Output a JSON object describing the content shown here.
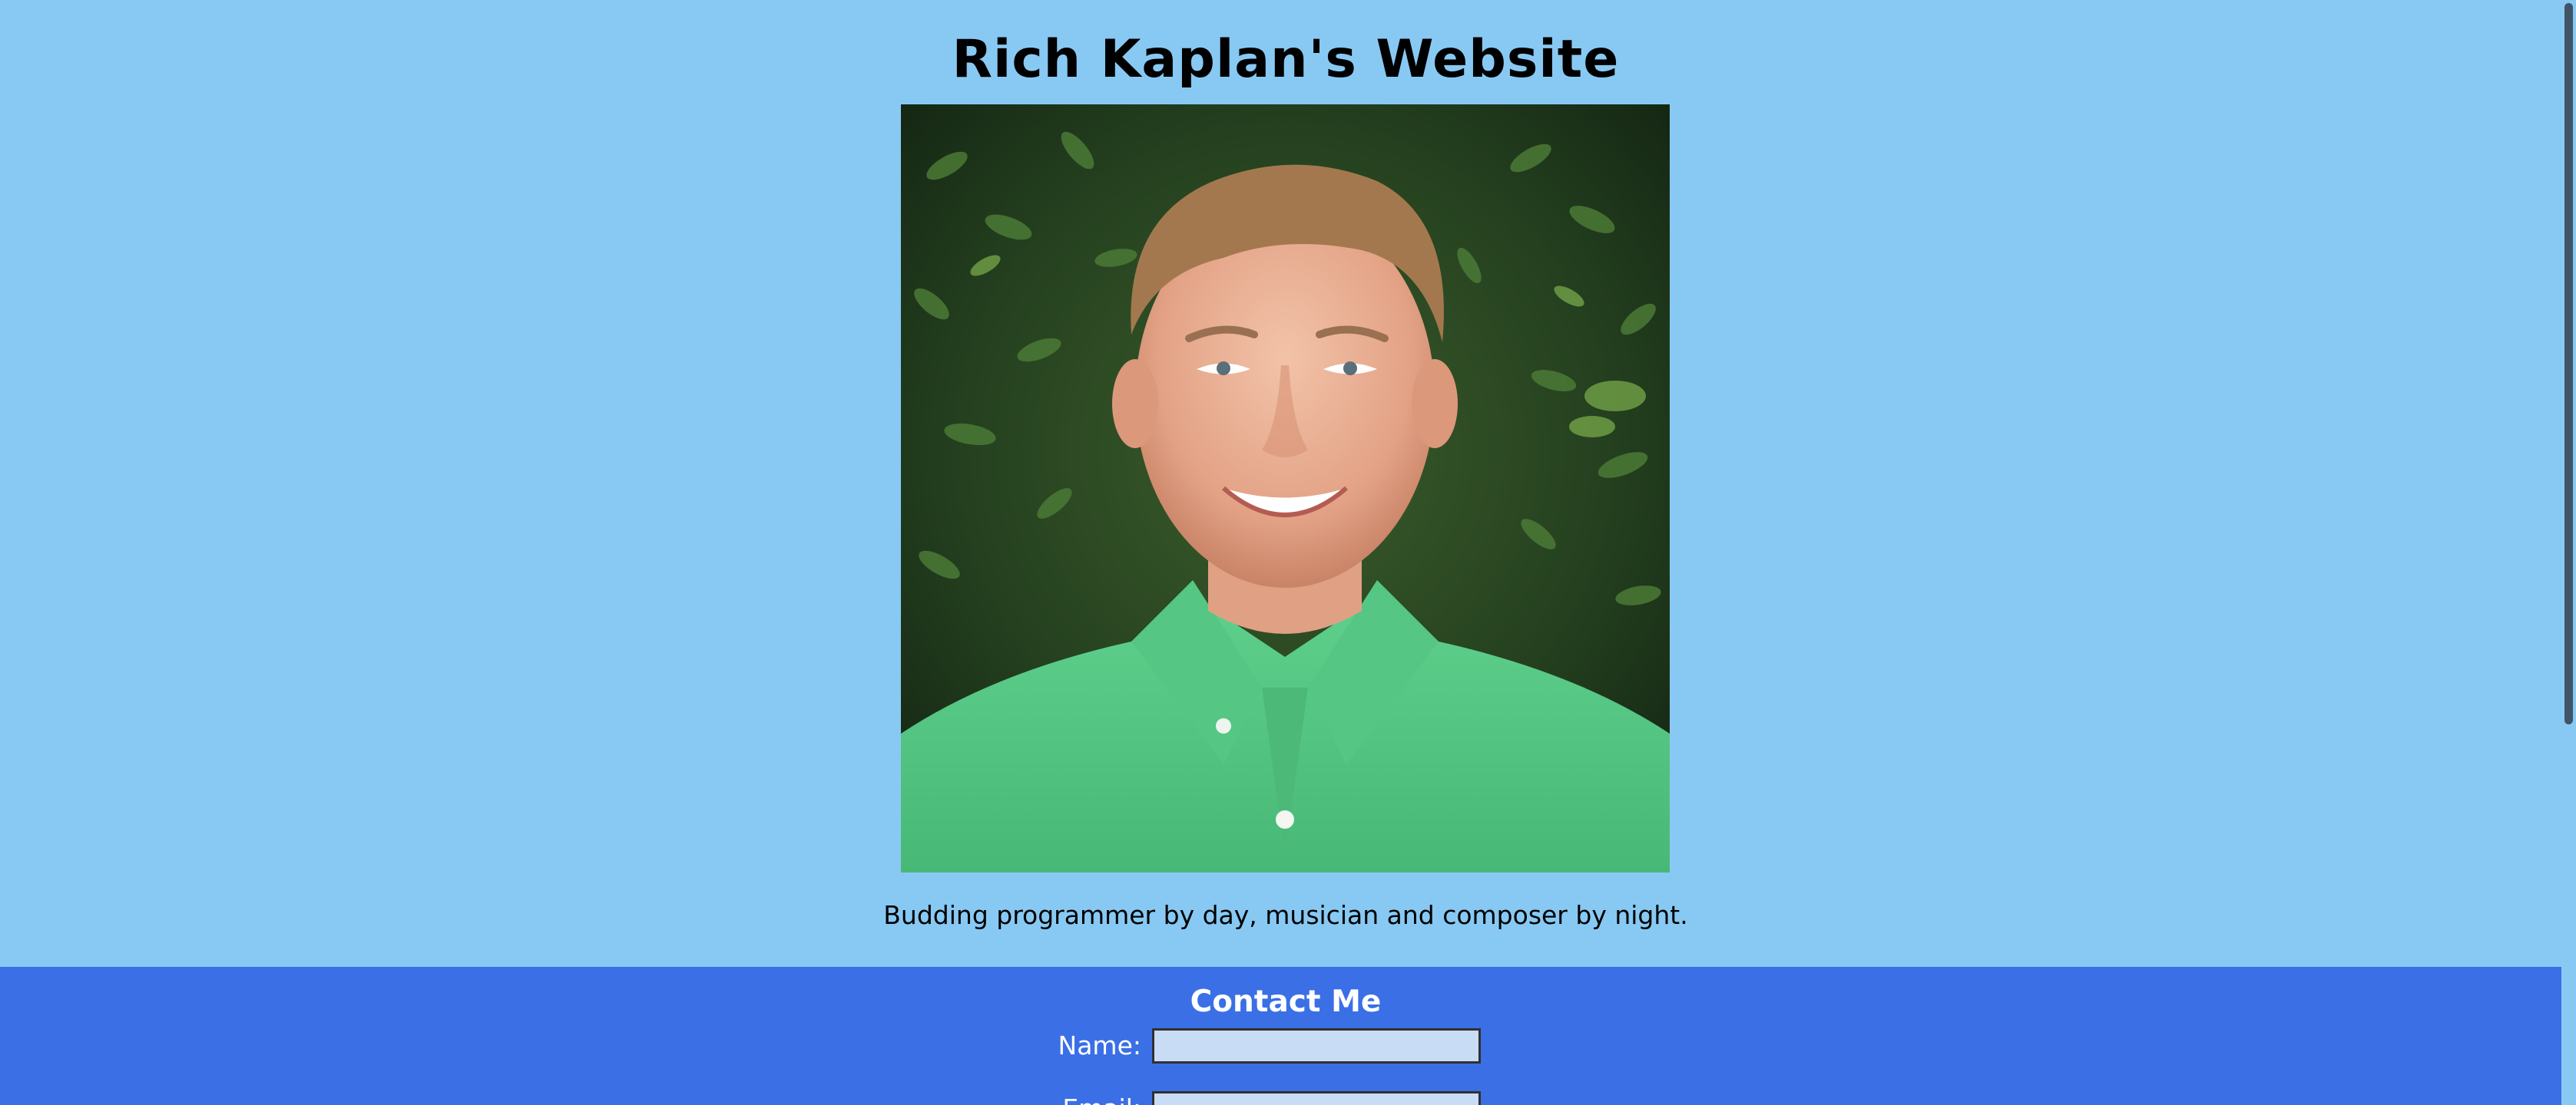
{
  "page": {
    "title": "Rich Kaplan's Website",
    "tagline": "Budding programmer by day, musician and composer by night."
  },
  "portrait": {
    "description_icon": "portrait-photo"
  },
  "contact": {
    "heading": "Contact Me",
    "name_label": "Name:",
    "name_value": "",
    "email_label": "Email:",
    "email_value": ""
  },
  "colors": {
    "page_background": "#88c9f3",
    "contact_background": "#3a6fe6",
    "input_background": "#c9dcf6"
  }
}
